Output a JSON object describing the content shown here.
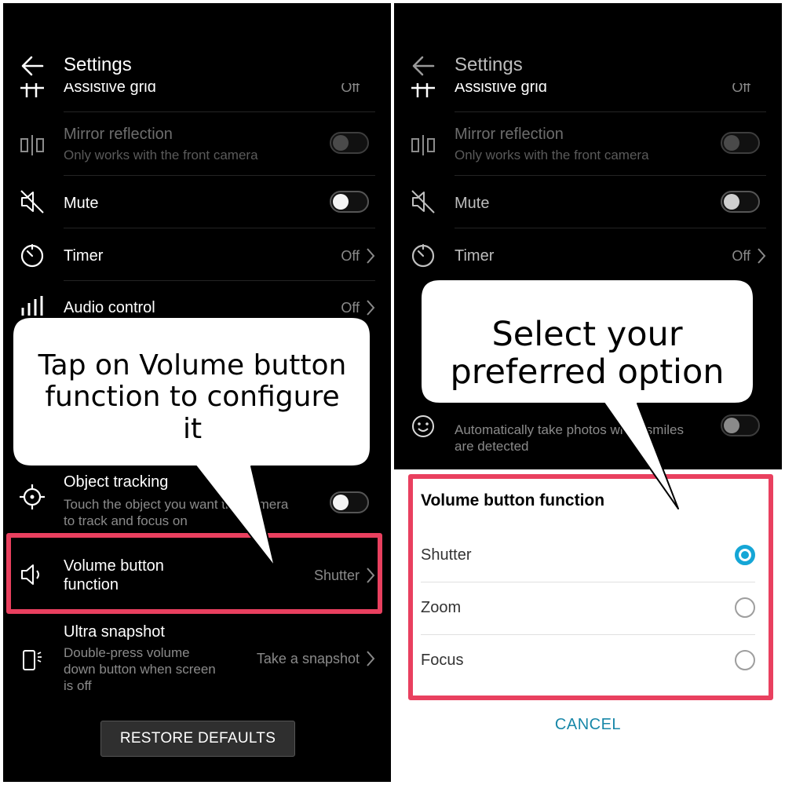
{
  "accent_color": "#15a6d6",
  "highlight_color": "#e9405f",
  "left": {
    "appbar": {
      "title": "Settings",
      "back_icon": "arrow-left-icon"
    },
    "rows": {
      "assistive_grid": {
        "label": "Assistive grid",
        "value": "Off"
      },
      "mirror": {
        "label": "Mirror reflection",
        "sub": "Only works with the front camera"
      },
      "mute": {
        "label": "Mute"
      },
      "timer": {
        "label": "Timer",
        "value": "Off"
      },
      "audio": {
        "label": "Audio control",
        "value": "Off"
      },
      "object_tracking": {
        "label": "Object tracking",
        "sub_line1": "Touch the object you want the camera",
        "sub_line2": "to track and focus on"
      },
      "volume": {
        "label_line1": "Volume button",
        "label_line2": "function",
        "value": "Shutter"
      },
      "ultra": {
        "label": "Ultra snapshot",
        "sub_line1": "Double-press volume",
        "sub_line2": "down button when screen",
        "sub_line3": "is off",
        "value": "Take a snapshot"
      }
    },
    "restore_button": "RESTORE DEFAULTS",
    "callout": {
      "line1": "Tap on Volume button",
      "line2": "function to configure",
      "line3": "it"
    }
  },
  "right": {
    "appbar": {
      "title": "Settings",
      "back_icon": "arrow-left-icon"
    },
    "rows": {
      "assistive_grid": {
        "label": "Assistive grid",
        "value": "Off"
      },
      "mirror": {
        "label": "Mirror reflection",
        "sub": "Only works with the front camera"
      },
      "mute": {
        "label": "Mute"
      },
      "timer": {
        "label": "Timer",
        "value": "Off"
      },
      "smile": {
        "sub_line1": "Automatically take photos when smiles",
        "sub_line2": "are detected"
      }
    },
    "callout": {
      "line1": "Select your",
      "line2": "preferred option"
    },
    "dialog": {
      "title": "Volume button function",
      "options": [
        {
          "label": "Shutter",
          "selected": true
        },
        {
          "label": "Zoom",
          "selected": false
        },
        {
          "label": "Focus",
          "selected": false
        }
      ],
      "cancel_label": "CANCEL"
    }
  }
}
